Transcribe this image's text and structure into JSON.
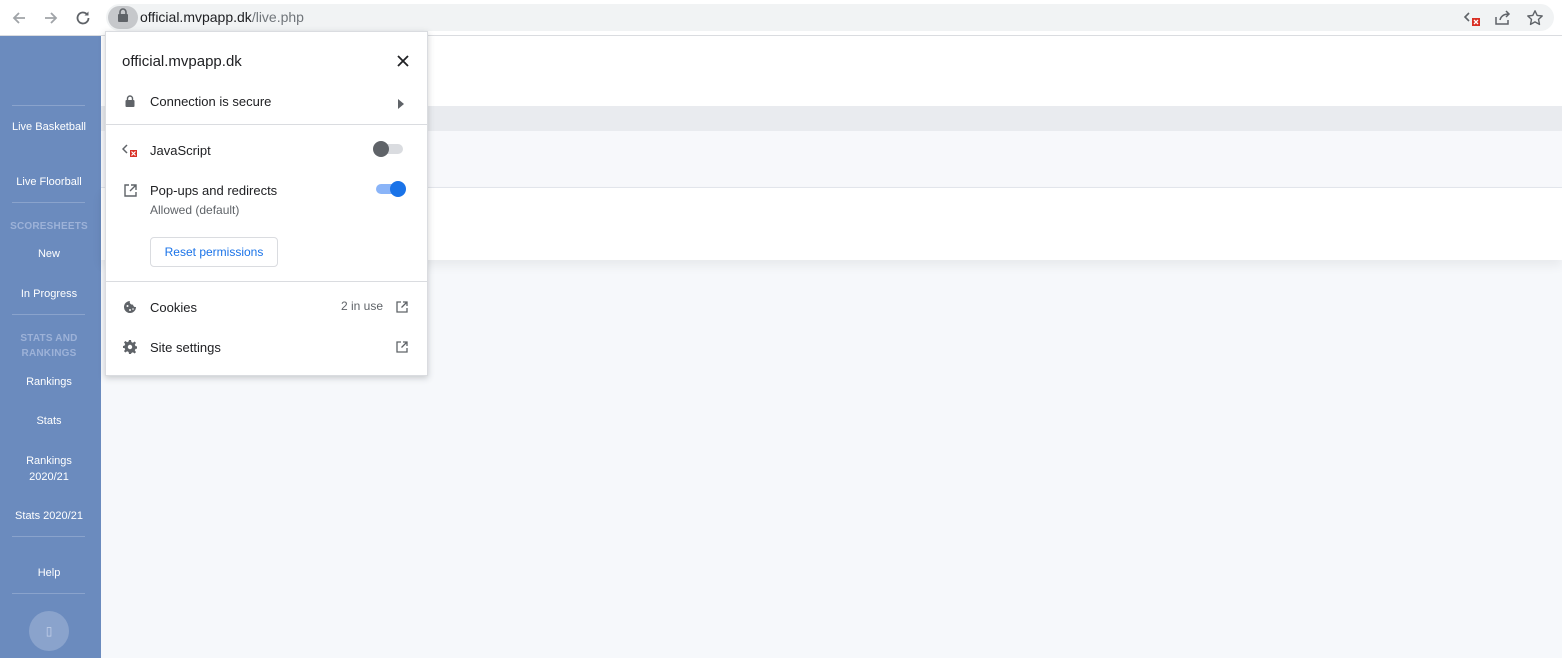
{
  "browser": {
    "url_domain": "official.mvpapp.dk",
    "url_path": "/live.php",
    "icons": [
      "back-arrow-icon",
      "forward-arrow-icon",
      "reload-icon",
      "lock-icon",
      "javascript-blocked-icon",
      "share-icon",
      "bookmark-star-icon"
    ]
  },
  "sidebar": {
    "items": [
      {
        "label": "Live Basketball"
      },
      {
        "label": "Live Floorball"
      }
    ],
    "section_scoresheets": "SCORESHEETS",
    "scoresheets": [
      {
        "label": "New"
      },
      {
        "label": "In Progress"
      }
    ],
    "section_stats": "STATS AND RANKINGS",
    "stats": [
      {
        "label": "Rankings"
      },
      {
        "label": "Stats"
      },
      {
        "label": "Rankings 2020/21"
      },
      {
        "label": "Stats 2020/21"
      }
    ],
    "help_label": "Help",
    "avatar_glyph": "▯"
  },
  "site_info": {
    "domain": "official.mvpapp.dk",
    "connection_label": "Connection is secure",
    "javascript_label": "JavaScript",
    "javascript_enabled": false,
    "popups_label": "Pop-ups and redirects",
    "popups_sub": "Allowed (default)",
    "popups_enabled": true,
    "reset_label": "Reset permissions",
    "cookies_label": "Cookies",
    "cookies_count": "2 in use",
    "site_settings_label": "Site settings"
  },
  "colors": {
    "sidebar_bg": "#6b8bbe",
    "accent_blue": "#1a73e8"
  }
}
